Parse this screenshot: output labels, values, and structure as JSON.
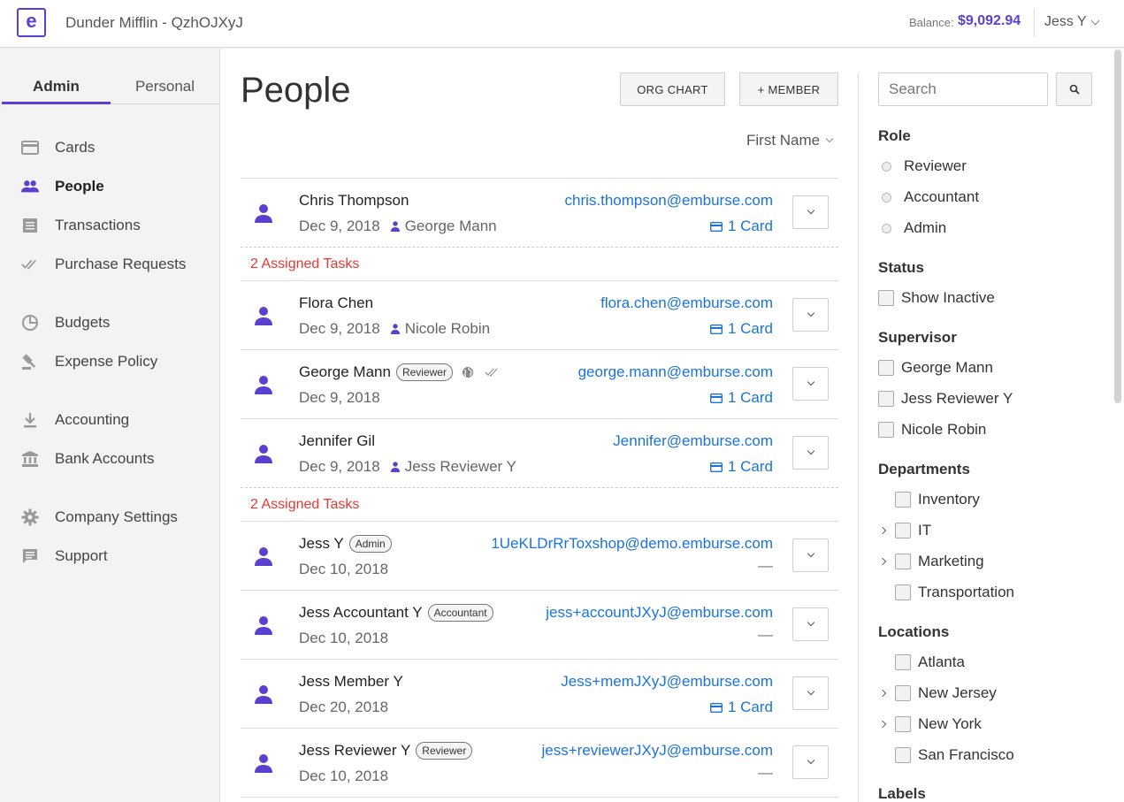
{
  "header": {
    "org_name": "Dunder Mifflin - QzhOJXyJ",
    "balance_label": "Balance:",
    "balance_value": "$9,092.94",
    "user": "Jess Y",
    "accent_color": "#5b3fd1"
  },
  "sidebar": {
    "tabs": [
      "Admin",
      "Personal"
    ],
    "active_tab": "Admin",
    "items": [
      {
        "label": "Cards",
        "icon": "card-icon"
      },
      {
        "label": "People",
        "icon": "people-icon",
        "active": true
      },
      {
        "label": "Transactions",
        "icon": "receipt-icon"
      },
      {
        "label": "Purchase Requests",
        "icon": "double-check-icon"
      },
      {
        "label": "Budgets",
        "icon": "pie-icon"
      },
      {
        "label": "Expense Policy",
        "icon": "gavel-icon"
      },
      {
        "label": "Accounting",
        "icon": "download-icon"
      },
      {
        "label": "Bank Accounts",
        "icon": "bank-icon"
      },
      {
        "label": "Company Settings",
        "icon": "gear-icon"
      },
      {
        "label": "Support",
        "icon": "chat-icon"
      }
    ]
  },
  "main": {
    "title": "People",
    "org_chart_label": "ORG CHART",
    "add_member_label": "+ MEMBER",
    "sort_label": "First Name",
    "tasks_label": "2 Assigned Tasks",
    "people": [
      {
        "name": "Chris Thompson",
        "badge": "",
        "date": "Dec 9, 2018",
        "supervisor": "George Mann",
        "email": "chris.thompson@emburse.com",
        "cards": "1 Card"
      },
      {
        "name": "Flora Chen",
        "badge": "",
        "date": "Dec 9, 2018",
        "supervisor": "Nicole Robin",
        "email": "flora.chen@emburse.com",
        "cards": "1 Card"
      },
      {
        "name": "George Mann",
        "badge": "Reviewer",
        "date": "Dec 9, 2018",
        "supervisor": "",
        "email": "george.mann@emburse.com",
        "cards": "1 Card"
      },
      {
        "name": "Jennifer Gil",
        "badge": "",
        "date": "Dec 9, 2018",
        "supervisor": "Jess Reviewer Y",
        "email": "Jennifer@emburse.com",
        "cards": "1 Card"
      },
      {
        "name": "Jess Y",
        "badge": "Admin",
        "date": "Dec 10, 2018",
        "supervisor": "",
        "email": "1UeKLDrRrToxshop@demo.emburse.com",
        "cards": "—"
      },
      {
        "name": "Jess Accountant Y",
        "badge": "Accountant",
        "date": "Dec 10, 2018",
        "supervisor": "",
        "email": "jess+accountJXyJ@emburse.com",
        "cards": "—"
      },
      {
        "name": "Jess Member Y",
        "badge": "",
        "date": "Dec 20, 2018",
        "supervisor": "",
        "email": "Jess+memJXyJ@emburse.com",
        "cards": "1 Card"
      },
      {
        "name": "Jess Reviewer Y",
        "badge": "Reviewer",
        "date": "Dec 10, 2018",
        "supervisor": "",
        "email": "jess+reviewerJXyJ@emburse.com",
        "cards": "—"
      }
    ]
  },
  "filters": {
    "search_placeholder": "Search",
    "role_heading": "Role",
    "roles": [
      "Reviewer",
      "Accountant",
      "Admin"
    ],
    "status_heading": "Status",
    "status_option": "Show Inactive",
    "supervisor_heading": "Supervisor",
    "supervisors": [
      "George Mann",
      "Jess Reviewer Y",
      "Nicole Robin"
    ],
    "departments_heading": "Departments",
    "departments": [
      "Inventory",
      "IT",
      "Marketing",
      "Transportation"
    ],
    "locations_heading": "Locations",
    "locations": [
      "Atlanta",
      "New Jersey",
      "New York",
      "San Francisco"
    ],
    "labels_heading": "Labels"
  }
}
